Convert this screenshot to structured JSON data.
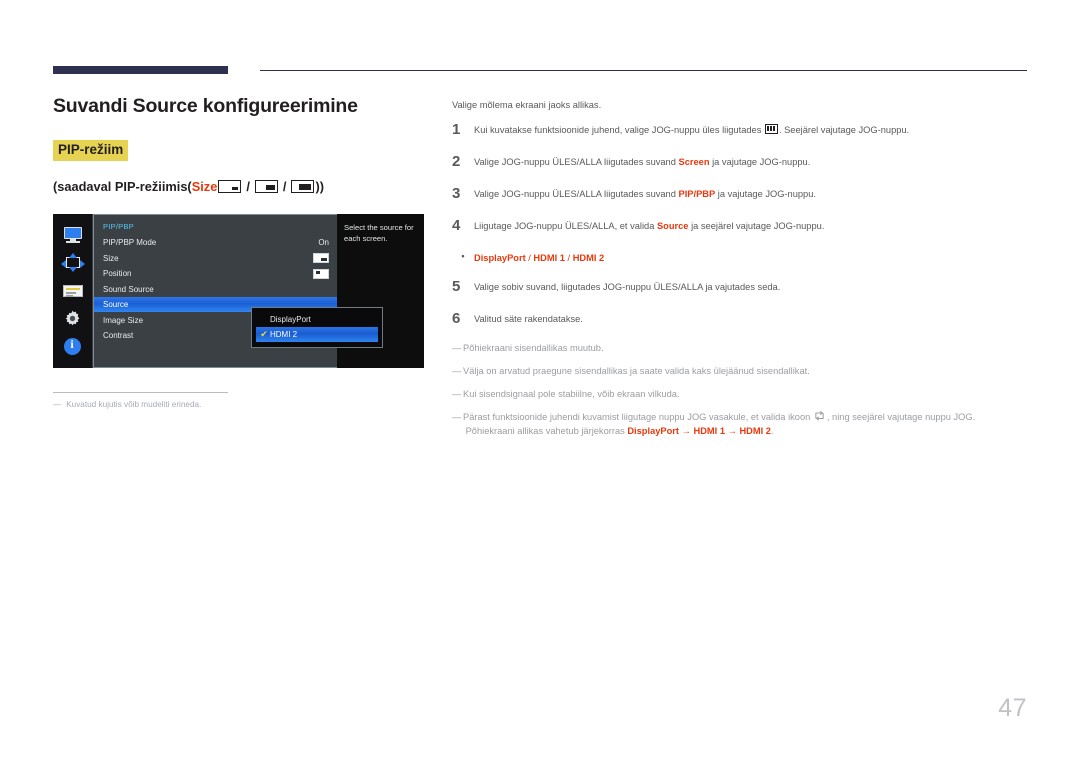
{
  "page": {
    "number": "47"
  },
  "left": {
    "title": "Suvandi Source konfigureerimine",
    "mode_badge": "PIP-režiim",
    "availability": {
      "prefix": "(saadaval PIP-režiimis(",
      "red_word": "Size",
      "separator": "/",
      "suffix": "))",
      "size_icons": [
        "size-small-icon",
        "size-medium-icon",
        "size-large-icon"
      ]
    },
    "osd": {
      "rail_icons": [
        "monitor-icon",
        "pip-pbp-icon",
        "osd-panel-icon",
        "gear-icon",
        "info-icon"
      ],
      "menu_header": "PIP/PBP",
      "rows": [
        {
          "label": "PIP/PBP Mode",
          "value": "On",
          "value_type": "text",
          "active": false
        },
        {
          "label": "Size",
          "value": "",
          "value_type": "size-glyph",
          "active": false
        },
        {
          "label": "Position",
          "value": "",
          "value_type": "position-glyph",
          "active": false
        },
        {
          "label": "Sound Source",
          "value": "",
          "value_type": "none",
          "active": false
        },
        {
          "label": "Source",
          "value": "",
          "value_type": "none",
          "active": true
        },
        {
          "label": "Image Size",
          "value": "",
          "value_type": "none",
          "active": false
        },
        {
          "label": "Contrast",
          "value": "",
          "value_type": "none",
          "active": false
        }
      ],
      "dropdown": {
        "options": [
          {
            "label": "DisplayPort",
            "selected": false
          },
          {
            "label": "HDMI 2",
            "selected": true
          }
        ],
        "check_mark": "✔"
      },
      "help_text": "Select the source for each screen."
    },
    "image_note": {
      "dash": "—",
      "text": "Kuvatud kujutis võib mudeliti erineda."
    }
  },
  "right": {
    "intro": "Valige mõlema ekraani jaoks allikas.",
    "steps": [
      {
        "num": "1",
        "parts": [
          {
            "t": "Kui kuvatakse funktsioonide juhend, valige JOG-nuppu üles liigutades ",
            "style": "plain"
          },
          {
            "t": "menu-icon",
            "style": "icon-menu"
          },
          {
            "t": ". Seejärel vajutage JOG-nuppu.",
            "style": "plain"
          }
        ]
      },
      {
        "num": "2",
        "parts": [
          {
            "t": "Valige JOG-nuppu ÜLES/ALLA liigutades suvand ",
            "style": "plain"
          },
          {
            "t": "Screen",
            "style": "red-bold"
          },
          {
            "t": " ja vajutage JOG-nuppu.",
            "style": "plain"
          }
        ]
      },
      {
        "num": "3",
        "parts": [
          {
            "t": "Valige JOG-nuppu ÜLES/ALLA liigutades suvand ",
            "style": "plain"
          },
          {
            "t": "PIP/PBP",
            "style": "red-bold"
          },
          {
            "t": " ja vajutage JOG-nuppu.",
            "style": "plain"
          }
        ]
      },
      {
        "num": "4",
        "parts": [
          {
            "t": "Liigutage JOG-nuppu ÜLES/ALLA, et valida ",
            "style": "plain"
          },
          {
            "t": "Source",
            "style": "red-bold"
          },
          {
            "t": " ja seejärel vajutage JOG-nuppu.",
            "style": "plain"
          }
        ]
      },
      {
        "num": "•",
        "bullet": true,
        "parts": [
          {
            "t": "DisplayPort",
            "style": "red-bold"
          },
          {
            "t": " / ",
            "style": "red-plain"
          },
          {
            "t": "HDMI 1",
            "style": "red-bold"
          },
          {
            "t": " / ",
            "style": "red-plain"
          },
          {
            "t": "HDMI 2",
            "style": "red-bold"
          }
        ]
      },
      {
        "num": "5",
        "parts": [
          {
            "t": "Valige sobiv suvand, liigutades JOG-nuppu ÜLES/ALLA ja vajutades seda.",
            "style": "plain"
          }
        ]
      },
      {
        "num": "6",
        "parts": [
          {
            "t": "Valitud säte rakendatakse.",
            "style": "plain"
          }
        ]
      }
    ],
    "notes": [
      {
        "dash": "―",
        "parts": [
          {
            "t": "Põhiekraani sisendallikas muutub.",
            "style": "plain"
          }
        ]
      },
      {
        "dash": "―",
        "parts": [
          {
            "t": "Välja on arvatud praegune sisendallikas ja saate valida kaks ülejäänud sisendallikat.",
            "style": "plain"
          }
        ]
      },
      {
        "dash": "―",
        "parts": [
          {
            "t": "Kui sisendsignaal pole stabiilne, võib ekraan vilkuda.",
            "style": "plain"
          }
        ]
      },
      {
        "dash": "―",
        "parts": [
          {
            "t": "Pärast funktsioonide juhendi kuvamist liigutage nuppu JOG vasakule, et valida ikoon ",
            "style": "plain"
          },
          {
            "t": "swap-icon",
            "style": "icon-swap"
          },
          {
            "t": ", ning seejärel vajutage nuppu JOG.",
            "style": "plain"
          },
          {
            "t": "BREAK",
            "style": "break"
          },
          {
            "t": "Põhiekraani allikas vahetub järjekorras ",
            "style": "plain"
          },
          {
            "t": "DisplayPort",
            "style": "red-bold"
          },
          {
            "t": " → ",
            "style": "red-plain"
          },
          {
            "t": "HDMI 1",
            "style": "red-bold"
          },
          {
            "t": " → ",
            "style": "red-plain"
          },
          {
            "t": "HDMI 2",
            "style": "red-bold"
          },
          {
            "t": ".",
            "style": "plain"
          }
        ]
      }
    ]
  },
  "colors": {
    "accent_red": "#e8380d",
    "badge_yellow": "#e7d352",
    "rule_navy": "#2e3050",
    "osd_blue": "#2c77e8",
    "osd_cyan": "#54c6f0",
    "check_yellow": "#eedb3a"
  }
}
